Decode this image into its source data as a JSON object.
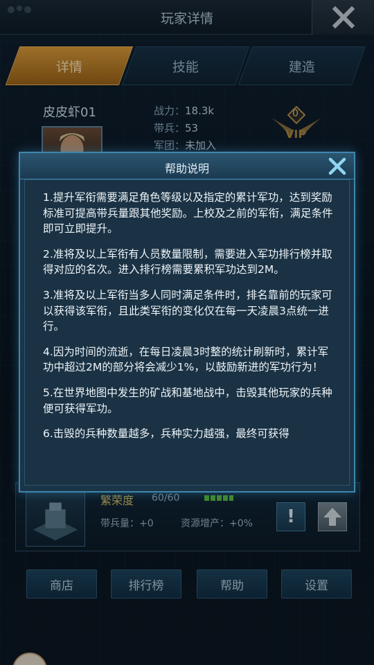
{
  "window": {
    "title": "玩家详情"
  },
  "tabs": [
    {
      "label": "详情",
      "active": true
    },
    {
      "label": "技能",
      "active": false
    },
    {
      "label": "建造",
      "active": false
    }
  ],
  "player": {
    "name": "皮皮虾01",
    "stats": [
      {
        "label": "战力：",
        "value": "18.3k"
      },
      {
        "label": "带兵：",
        "value": "53"
      },
      {
        "label": "军团：",
        "value": "未加入"
      }
    ],
    "vip_level": "0",
    "vip_label": "VIP"
  },
  "building": {
    "name": "繁荣度",
    "count": "60/60",
    "troops": "带兵量：+0",
    "resource": "资源增产：+0%",
    "info_symbol": "!"
  },
  "bottom_buttons": [
    {
      "label": "商店"
    },
    {
      "label": "排行榜"
    },
    {
      "label": "帮助"
    },
    {
      "label": "设置"
    }
  ],
  "dialog": {
    "title": "帮助说明",
    "paragraphs": [
      "1.提升军衔需要满足角色等级以及指定的累计军功，达到奖励标准可提高带兵量跟其他奖励。上校及之前的军衔，满足条件即可立即提升。",
      "2.准将及以上军衔有人员数量限制，需要进入军功排行榜并取得对应的名次。进入排行榜需要累积军功达到2M。",
      "3.准将及以上军衔当多人同时满足条件时，排名靠前的玩家可以获得该军衔，且此类军衔的变化仅在每一天凌晨3点统一进行。",
      "4.因为时间的流逝，在每日凌晨3时整的统计刷新时，累计军功中超过2M的部分将会减少1%，以鼓励新进的军功行为！",
      "5.在世界地图中发生的矿战和基地战中，击毁其他玩家的兵种便可获得军功。",
      "6.击毁的兵种数量越多，兵种实力越强，最终可获得"
    ]
  },
  "colors": {
    "accent": "#3f86ad",
    "active_tab": "#e0a03a",
    "panel": "#1a3244"
  }
}
